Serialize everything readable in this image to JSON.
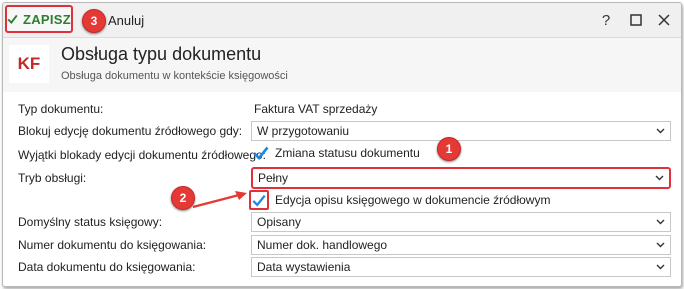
{
  "toolbar": {
    "save_label": "ZAPISZ",
    "cancel_label": "Anuluj",
    "help_label": "?"
  },
  "header": {
    "logo_text": "KF",
    "title": "Obsługa typu dokumentu",
    "subtitle": "Obsługa dokumentu w kontekście księgowości"
  },
  "form": {
    "doc_type_label": "Typ dokumentu:",
    "doc_type_value": "Faktura VAT sprzedaży",
    "block_label": "Blokuj edycję dokumentu źródłowego gdy:",
    "block_value": "W przygotowaniu",
    "exceptions_label": "Wyjątki blokady edycji dokumentu źródłowego:",
    "exceptions_checkbox_label": "Zmiana statusu dokumentu",
    "exceptions_checked": true,
    "mode_label": "Tryb obsługi:",
    "mode_value": "Pełny",
    "edit_desc_checkbox_label": "Edycja opisu księgowego w dokumencie źródłowym",
    "edit_desc_checked": true,
    "default_status_label": "Domyślny status księgowy:",
    "default_status_value": "Opisany",
    "number_label": "Numer dokumentu do księgowania:",
    "number_value": "Numer dok. handlowego",
    "date_label": "Data dokumentu do księgowania:",
    "date_value": "Data wystawienia"
  },
  "callouts": {
    "one": "1",
    "two": "2",
    "three": "3"
  },
  "colors": {
    "accent_red": "#e0303a",
    "check_blue": "#1e88e5",
    "save_green": "#2e7d32"
  },
  "icons": [
    "check-icon",
    "close-icon",
    "help-icon",
    "maximize-icon",
    "chevron-down-icon",
    "arrow-icon"
  ]
}
